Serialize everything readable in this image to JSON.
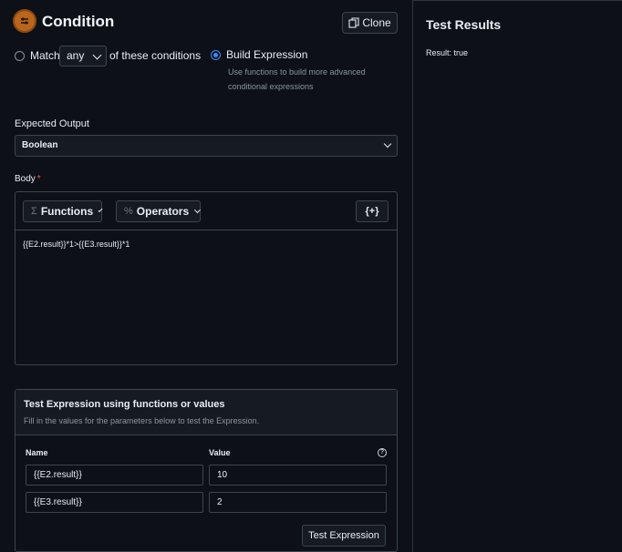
{
  "header": {
    "title": "Condition",
    "clone_label": "Clone"
  },
  "match": {
    "match_label": "Match",
    "match_value": "any",
    "suffix": "of these conditions",
    "build_label": "Build Expression",
    "build_desc_1": "Use functions to build more advanced",
    "build_desc_2": "conditional expressions",
    "selected": "build"
  },
  "expected_output": {
    "label": "Expected Output",
    "value": "Boolean"
  },
  "body": {
    "label": "Body",
    "required_mark": "*",
    "functions_label": "Functions",
    "operators_label": "Operators",
    "variables_label": "{+}",
    "expression": "{{E2.result}}*1>{{E3.result}}*1"
  },
  "test": {
    "title": "Test Expression using functions or values",
    "subtitle": "Fill in the values for the parameters below to test the Expression.",
    "name_header": "Name",
    "value_header": "Value",
    "rows": [
      {
        "name": "{{E2.result}}",
        "value": "10"
      },
      {
        "name": "{{E3.result}}",
        "value": "2"
      }
    ],
    "button_label": "Test Expression"
  },
  "results": {
    "title": "Test Results",
    "result_text": "Result: true"
  },
  "icons": {
    "condition": "condition-icon",
    "clone": "copy-icon",
    "functions": "sigma-icon",
    "operators": "percent-icon",
    "help": "help-circle-icon"
  },
  "colors": {
    "accent": "#388bfd",
    "brand": "#b9651c",
    "required": "#f85149"
  }
}
